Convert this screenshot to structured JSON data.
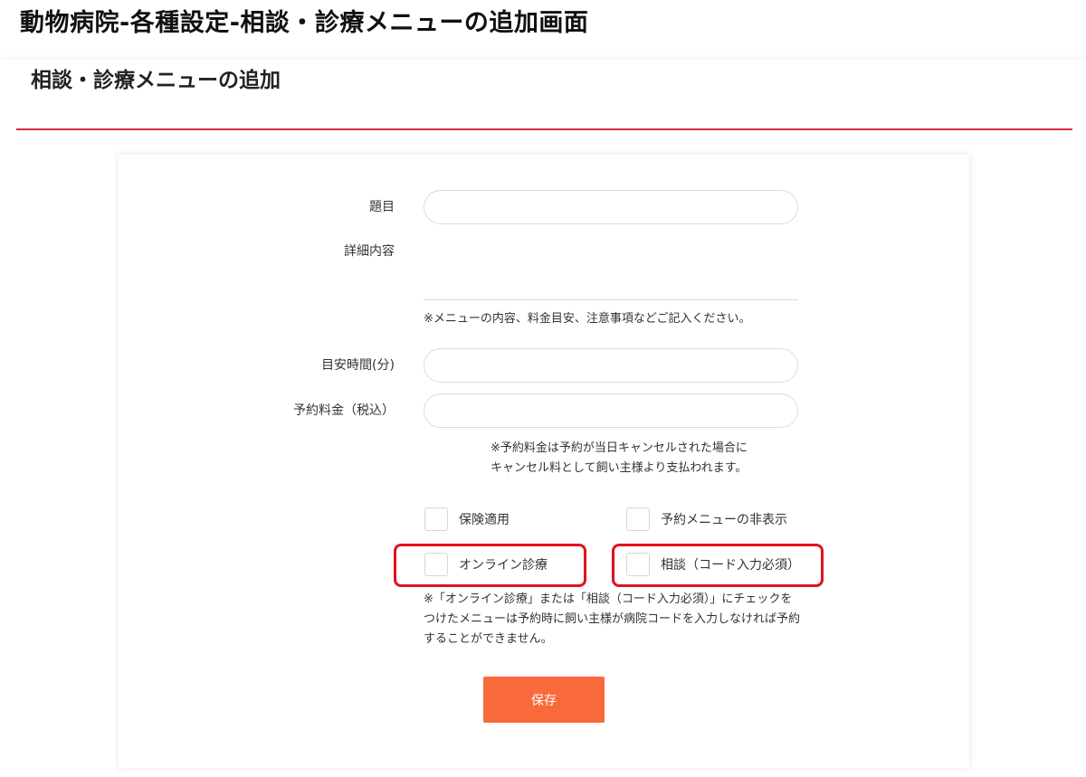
{
  "doc_title": "動物病院-各種設定-相談・診療メニューの追加画面",
  "page_title": "相談・診療メニューの追加",
  "form": {
    "title_label": "題目",
    "title_value": "",
    "detail_label": "詳細内容",
    "detail_value": "",
    "detail_note": "※メニューの内容、料金目安、注意事項などご記入ください。",
    "duration_label": "目安時間(分)",
    "duration_value": "",
    "fee_label": "予約料金（税込）",
    "fee_value": "",
    "fee_note_line1": "※予約料金は予約が当日キャンセルされた場合に",
    "fee_note_line2": "キャンセル料として飼い主様より支払われます。",
    "checkboxes": {
      "insurance": "保険適用",
      "hide_menu": "予約メニューの非表示",
      "online": "オンライン診療",
      "consult": "相談（コード入力必須）"
    },
    "code_note_line1": "※「オンライン診療」または「相談（コード入力必須）」にチェックを",
    "code_note_line2": "つけたメニューは予約時に飼い主様が病院コードを入力しなければ予約",
    "code_note_line3": "することができません。",
    "save_label": "保存"
  },
  "colors": {
    "accent_line": "#d62b43",
    "save_button": "#f96a3a",
    "highlight_border": "#e0121f"
  }
}
